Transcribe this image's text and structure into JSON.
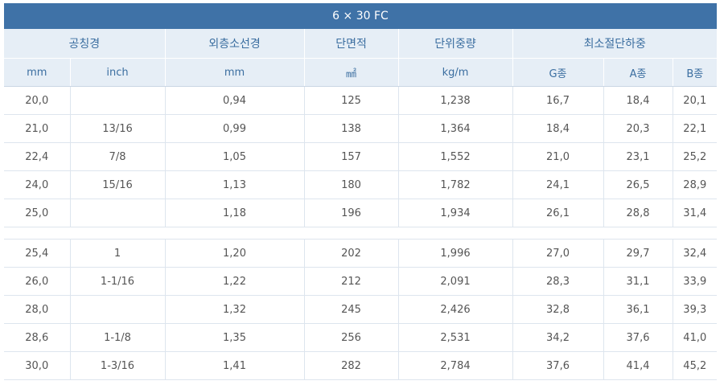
{
  "title": "6 × 30 FC",
  "header_top": [
    "공칭경",
    "외층소선경",
    "단면적",
    "단위중량",
    "최소절단하중"
  ],
  "header_sub": [
    "mm",
    "inch",
    "mm",
    "㎟",
    "kg/m",
    "G종",
    "A종",
    "B종"
  ],
  "groups": [
    {
      "rows": [
        [
          "20,0",
          "",
          "0,94",
          "125",
          "1,238",
          "16,7",
          "18,4",
          "20,1"
        ],
        [
          "21,0",
          "13/16",
          "0,99",
          "138",
          "1,364",
          "18,4",
          "20,3",
          "22,1"
        ],
        [
          "22,4",
          "7/8",
          "1,05",
          "157",
          "1,552",
          "21,0",
          "23,1",
          "25,2"
        ],
        [
          "24,0",
          "15/16",
          "1,13",
          "180",
          "1,782",
          "24,1",
          "26,5",
          "28,9"
        ],
        [
          "25,0",
          "",
          "1,18",
          "196",
          "1,934",
          "26,1",
          "28,8",
          "31,4"
        ]
      ]
    },
    {
      "rows": [
        [
          "25,4",
          "1",
          "1,20",
          "202",
          "1,996",
          "27,0",
          "29,7",
          "32,4"
        ],
        [
          "26,0",
          "1-1/16",
          "1,22",
          "212",
          "2,091",
          "28,3",
          "31,1",
          "33,9"
        ],
        [
          "28,0",
          "",
          "1,32",
          "245",
          "2,426",
          "32,8",
          "36,1",
          "39,3"
        ],
        [
          "28,6",
          "1-1/8",
          "1,35",
          "256",
          "2,531",
          "34,2",
          "37,6",
          "41,0"
        ],
        [
          "30,0",
          "1-3/16",
          "1,41",
          "282",
          "2,784",
          "37,6",
          "41,4",
          "45,2"
        ]
      ]
    }
  ]
}
